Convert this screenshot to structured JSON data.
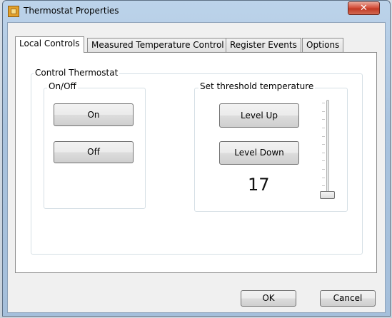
{
  "window": {
    "title": "Thermostat Properties",
    "close_glyph": "✕"
  },
  "tabs": [
    {
      "label": "Local Controls",
      "active": true
    },
    {
      "label": "Measured Temperature Control",
      "active": false
    },
    {
      "label": "Register Events",
      "active": false
    },
    {
      "label": "Options",
      "active": false
    }
  ],
  "control_group": {
    "label": "Control Thermostat"
  },
  "onoff_group": {
    "label": "On/Off",
    "on_label": "On",
    "off_label": "Off"
  },
  "threshold_group": {
    "label": "Set threshold temperature",
    "level_up_label": "Level Up",
    "level_down_label": "Level Down",
    "value": "17"
  },
  "slider": {
    "level_fraction": 0.0
  },
  "footer": {
    "ok_label": "OK",
    "cancel_label": "Cancel"
  },
  "icons": {
    "app": "thermostat-app-icon",
    "close": "close-icon"
  }
}
